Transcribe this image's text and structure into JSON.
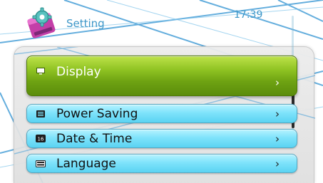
{
  "header": {
    "title": "Setting",
    "time": "17:39",
    "app_icon": "settings-gear-icon"
  },
  "menu": {
    "items": [
      {
        "label": "Display",
        "icon": "monitor-icon",
        "selected": true,
        "chevron": "›"
      },
      {
        "label": "Power Saving",
        "icon": "battery-list-icon",
        "selected": false,
        "chevron": "›"
      },
      {
        "label": "Date & Time",
        "icon": "calendar-icon",
        "selected": false,
        "chevron": "›"
      },
      {
        "label": "Language",
        "icon": "keyboard-icon",
        "selected": false,
        "chevron": "›"
      }
    ]
  },
  "colors": {
    "title_text": "#3d97c8",
    "selected_item": "#7cb518",
    "normal_item": "#7fe3fb",
    "background_lines": "#4aa0d8"
  },
  "icons": {
    "calendar_badge_text": "16"
  }
}
